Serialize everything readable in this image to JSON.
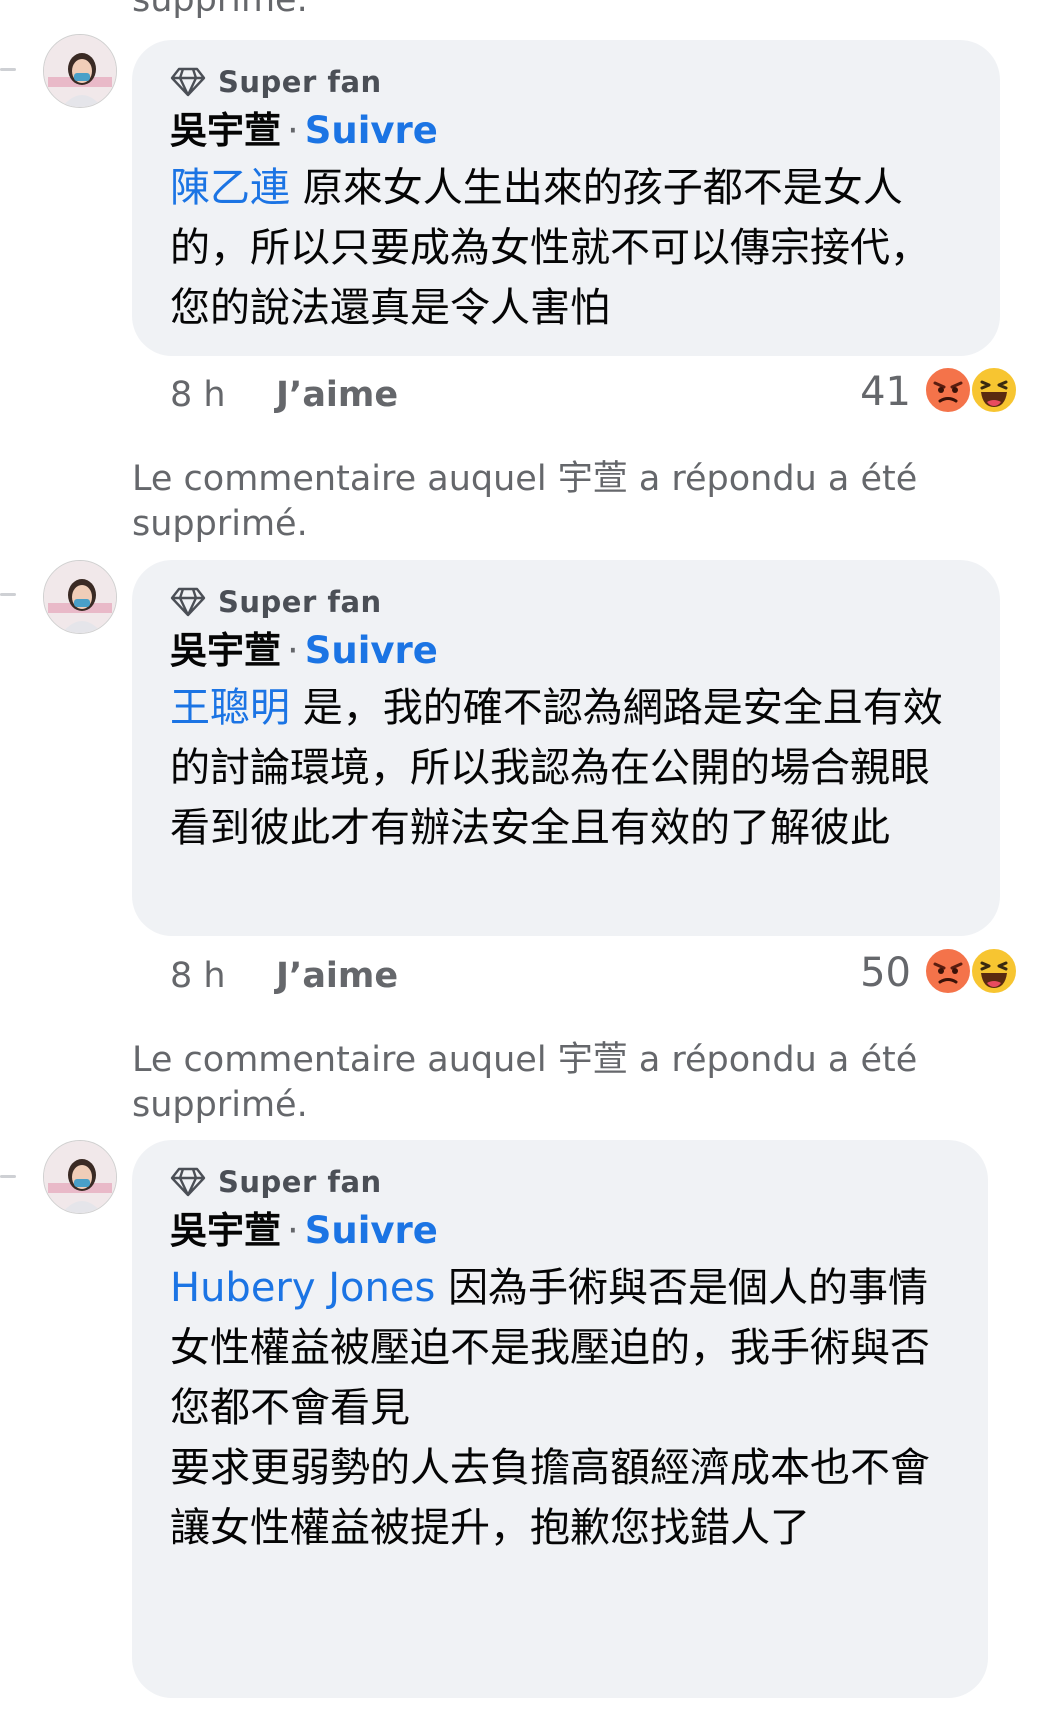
{
  "deleted_notice": "Le commentaire auquel 宇萱 a répondu a été supprimé.",
  "deleted_notice_top_fragment": "supprimé.",
  "badge_label": "Super fan",
  "author_name": "吳宇萱",
  "separator": "·",
  "follow_label": "Suivre",
  "time_label": "8 h",
  "like_label": "J’aime",
  "comments": [
    {
      "mention": "陳乙連",
      "lines": [
        "原來女人生出來的孩子都不是女人的，所以只要成為女性就不可以傳宗接代，您的說法還真是令人害怕"
      ],
      "reaction_count": "41"
    },
    {
      "mention": "王聰明",
      "lines": [
        "是，我的確不認為網路是安全且有效的討論環境，所以我認為在公開的場合親眼看到彼此才有辦法安全且有效的了解彼此"
      ],
      "reaction_count": "50"
    },
    {
      "mention": "Hubery Jones",
      "lines": [
        "因為手術與否是個人的事情",
        "女性權益被壓迫不是我壓迫的，我手術與否您都不會看見",
        "要求更弱勢的人去負擔高額經濟成本也不會讓女性權益被提升，抱歉您找錯人了"
      ]
    }
  ],
  "icons": {
    "badge": "diamond-icon",
    "reactions": [
      "angry-reaction-icon",
      "haha-reaction-icon"
    ]
  },
  "colors": {
    "link": "#1b74e4",
    "bubble": "#f0f2f5",
    "meta_text": "#65676b",
    "angry": "#f4734a",
    "haha": "#f7c531"
  }
}
